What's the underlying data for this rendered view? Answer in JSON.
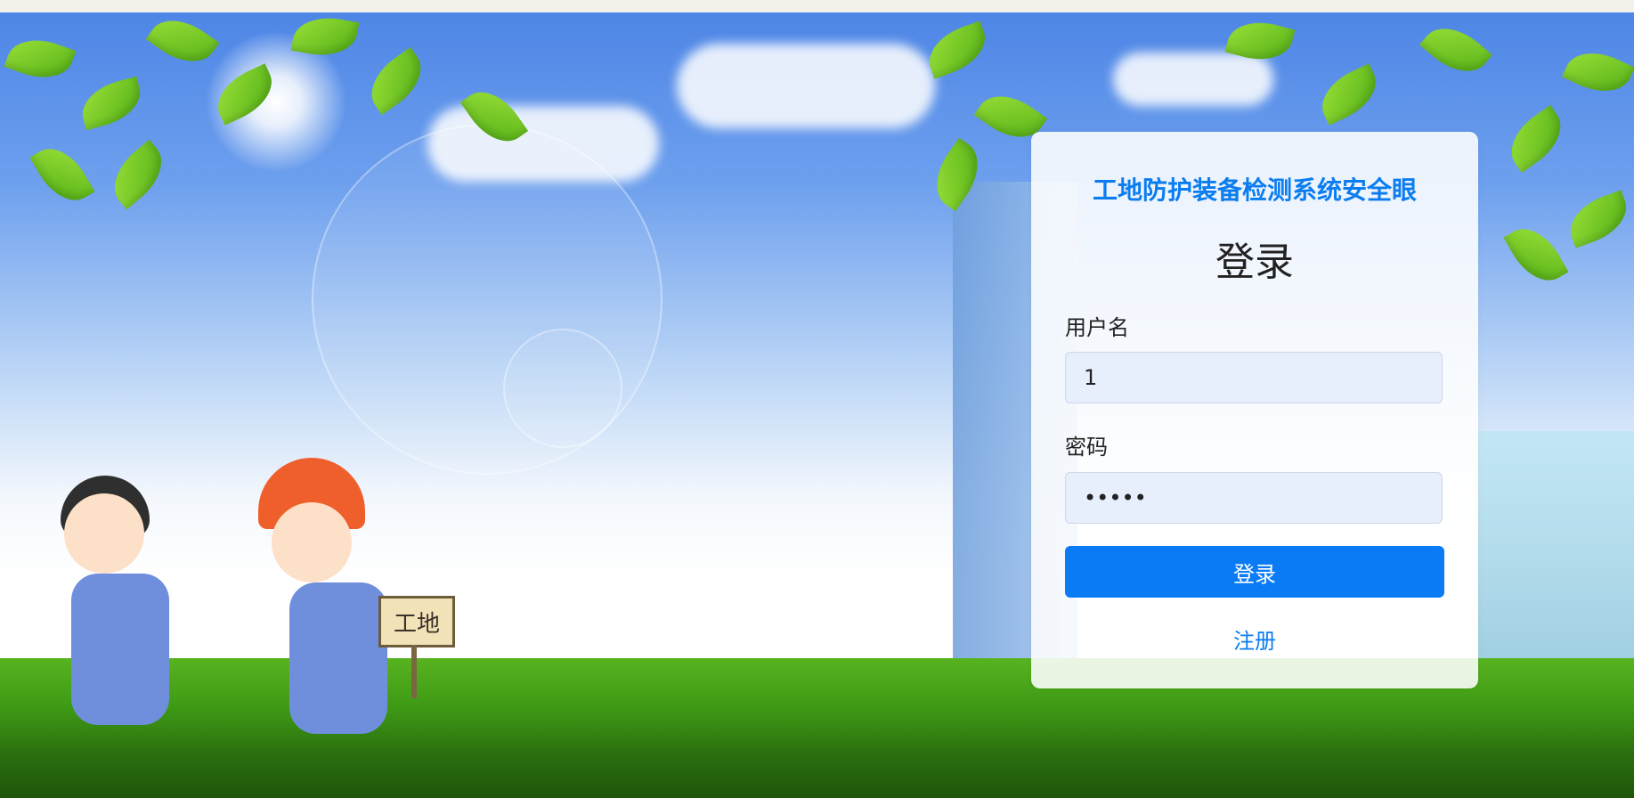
{
  "app": {
    "title": "工地防护装备检测系统安全眼"
  },
  "login": {
    "heading": "登录",
    "username_label": "用户名",
    "username_value": "1",
    "password_label": "密码",
    "password_value": "•••••",
    "submit_label": "登录",
    "register_label": "注册"
  },
  "scene": {
    "sign_text": "工地"
  },
  "colors": {
    "accent": "#0b7df0",
    "button": "#0a7bf5"
  }
}
